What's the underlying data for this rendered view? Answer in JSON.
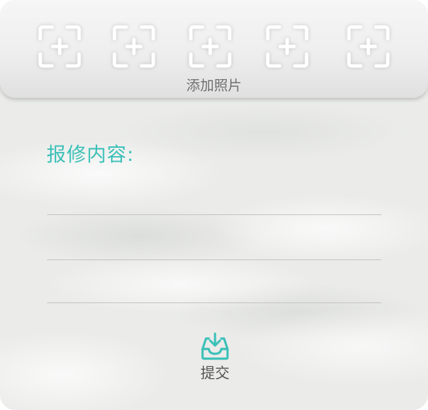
{
  "photos": {
    "add_label": "添加照片",
    "slot_icon": "add-photo-frame-icon",
    "slot_count": 5
  },
  "form": {
    "section_title": "报修内容:",
    "lines": [
      "",
      "",
      ""
    ]
  },
  "submit": {
    "label": "提交",
    "icon": "inbox-download-icon"
  },
  "colors": {
    "accent": "#3cc0b8",
    "slot_icon": "#ffffff",
    "line": "#c2c3c1",
    "label_text": "#6f6f6f"
  }
}
